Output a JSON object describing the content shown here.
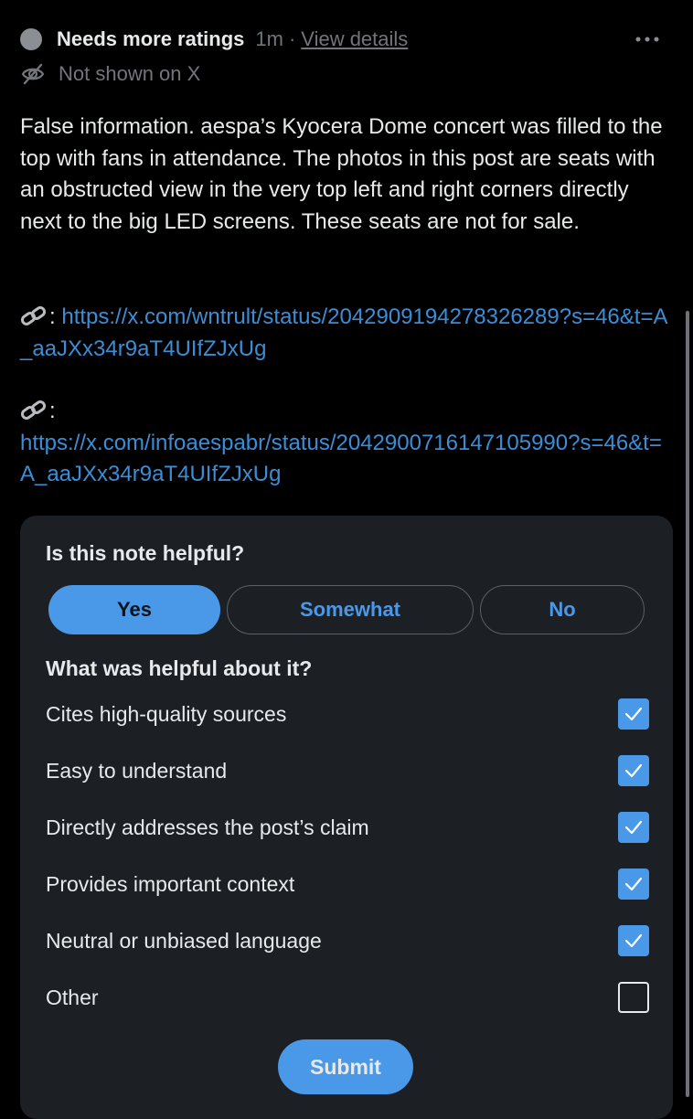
{
  "header": {
    "status_title": "Needs more ratings",
    "time": "1m",
    "separator": "·",
    "view_details": "View details",
    "not_shown": "Not shown on X",
    "more_icon": "more-horizontal-icon",
    "eye_off_icon": "eye-off-icon"
  },
  "note": {
    "text": "False information. aespa’s Kyocera Dome concert was filled to the top with fans in attendance. The photos in this post are seats with an obstructed view in the very top left and right corners directly next to the big LED screens. These seats are not for sale."
  },
  "sources": [
    {
      "icon": "link-icon",
      "colon": ":",
      "url": "https://x.com/wntrult/status/2042909194278326289?s=46&t=A_aaJXx34r9aT4UIfZJxUg"
    },
    {
      "icon": "link-icon",
      "colon": ":",
      "url": "https://x.com/infoaespabr/status/2042900716147105990?s=46&t=A_aaJXx34r9aT4UIfZJxUg"
    }
  ],
  "rating": {
    "question": "Is this note helpful?",
    "choices": {
      "yes": "Yes",
      "somewhat": "Somewhat",
      "no": "No"
    },
    "selected": "yes",
    "subquestion": "What was helpful about it?",
    "options": [
      {
        "label": "Cites high-quality sources",
        "checked": true
      },
      {
        "label": "Easy to understand",
        "checked": true
      },
      {
        "label": "Directly addresses the post’s claim",
        "checked": true
      },
      {
        "label": "Provides important context",
        "checked": true
      },
      {
        "label": "Neutral or unbiased language",
        "checked": true
      },
      {
        "label": "Other",
        "checked": false
      }
    ],
    "submit": "Submit"
  },
  "colors": {
    "background": "#000000",
    "card": "#1c1f23",
    "accent": "#4a99e9",
    "text": "#e7e9ea",
    "muted": "#71767b"
  }
}
